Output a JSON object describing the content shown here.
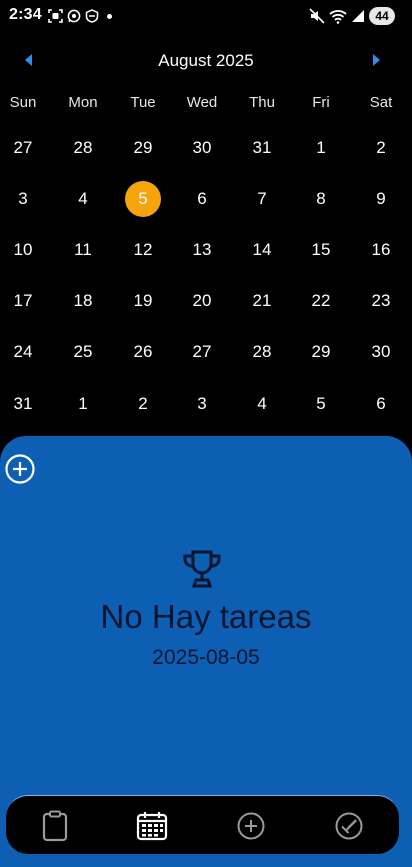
{
  "status_bar": {
    "time": "2:34",
    "battery": "44",
    "notification_icons": [
      "scan-icon",
      "whatsapp-icon",
      "shield-icon"
    ]
  },
  "calendar": {
    "month_title": "August 2025",
    "weekdays": [
      "Sun",
      "Mon",
      "Tue",
      "Wed",
      "Thu",
      "Fri",
      "Sat"
    ],
    "weeks": [
      [
        "27",
        "28",
        "29",
        "30",
        "31",
        "1",
        "2"
      ],
      [
        "3",
        "4",
        "5",
        "6",
        "7",
        "8",
        "9"
      ],
      [
        "10",
        "11",
        "12",
        "13",
        "14",
        "15",
        "16"
      ],
      [
        "17",
        "18",
        "19",
        "20",
        "21",
        "22",
        "23"
      ],
      [
        "24",
        "25",
        "26",
        "27",
        "28",
        "29",
        "30"
      ],
      [
        "31",
        "1",
        "2",
        "3",
        "4",
        "5",
        "6"
      ]
    ],
    "selected": "5",
    "selected_color": "#f5a50b"
  },
  "tasks_panel": {
    "empty_title": "No Hay tareas",
    "selected_date": "2025-08-05",
    "panel_color": "#0d5fb3"
  },
  "bottom_nav": {
    "items": [
      "clipboard-icon",
      "calendar-icon",
      "add-circle-icon",
      "check-circle-icon"
    ],
    "active": "calendar-icon"
  }
}
